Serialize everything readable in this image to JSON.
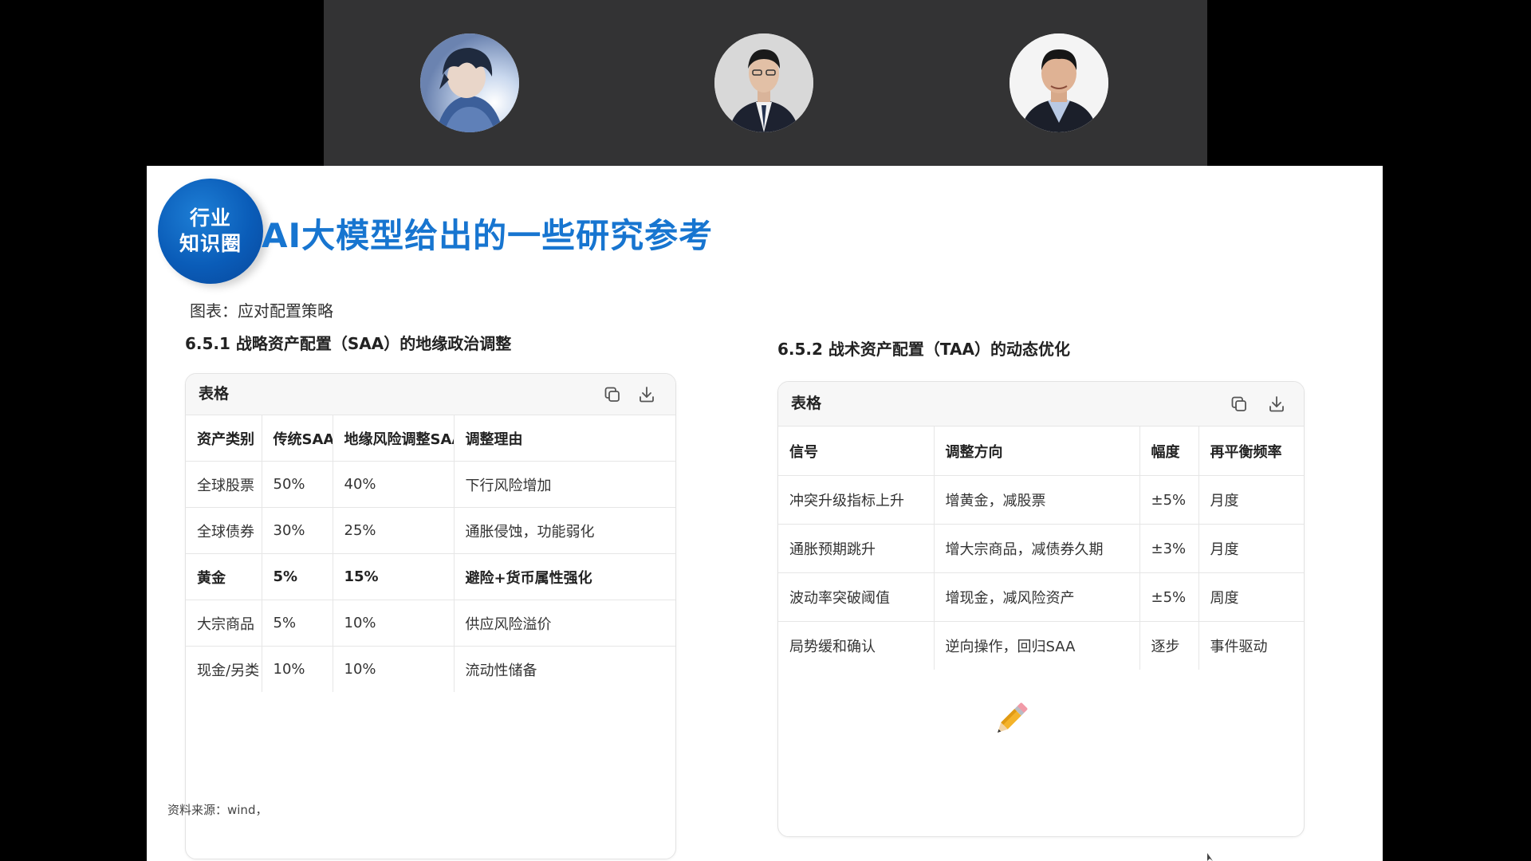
{
  "slide": {
    "logo_line1": "行业",
    "logo_line2": "知识圈",
    "title": "AI大模型给出的一些研究参考",
    "caption": "图表：应对配置策略",
    "source": "资料来源：wind，"
  },
  "left_table": {
    "heading": "6.5.1 战略资产配置（SAA）的地缘政治调整",
    "card_title": "表格",
    "columns": [
      "资产类别",
      "传统SAA",
      "地缘风险调整SAA",
      "调整理由"
    ],
    "rows": [
      [
        "全球股票",
        "50%",
        "40%",
        "下行风险增加"
      ],
      [
        "全球债券",
        "30%",
        "25%",
        "通胀侵蚀，功能弱化"
      ],
      [
        "黄金",
        "5%",
        "15%",
        "避险+货币属性强化"
      ],
      [
        "大宗商品",
        "5%",
        "10%",
        "供应风险溢价"
      ],
      [
        "现金/另类",
        "10%",
        "10%",
        "流动性储备"
      ]
    ]
  },
  "right_table": {
    "heading": "6.5.2 战术资产配置（TAA）的动态优化",
    "card_title": "表格",
    "columns": [
      "信号",
      "调整方向",
      "幅度",
      "再平衡频率"
    ],
    "rows": [
      [
        "冲突升级指标上升",
        "增黄金，减股票",
        "±5%",
        "月度"
      ],
      [
        "通胀预期跳升",
        "增大宗商品，减债券久期",
        "±3%",
        "月度"
      ],
      [
        "波动率突破阈值",
        "增现金，减风险资产",
        "±5%",
        "周度"
      ],
      [
        "局势缓和确认",
        "逆向操作，回归SAA",
        "逐步",
        "事件驱动"
      ]
    ]
  },
  "icons": {
    "copy": "copy-icon",
    "download": "download-icon",
    "pencil": "pencil-icon"
  },
  "colors": {
    "title_blue": "#1775d0",
    "badge_blue": "#0a5cb8",
    "participant_bar": "#333334"
  }
}
